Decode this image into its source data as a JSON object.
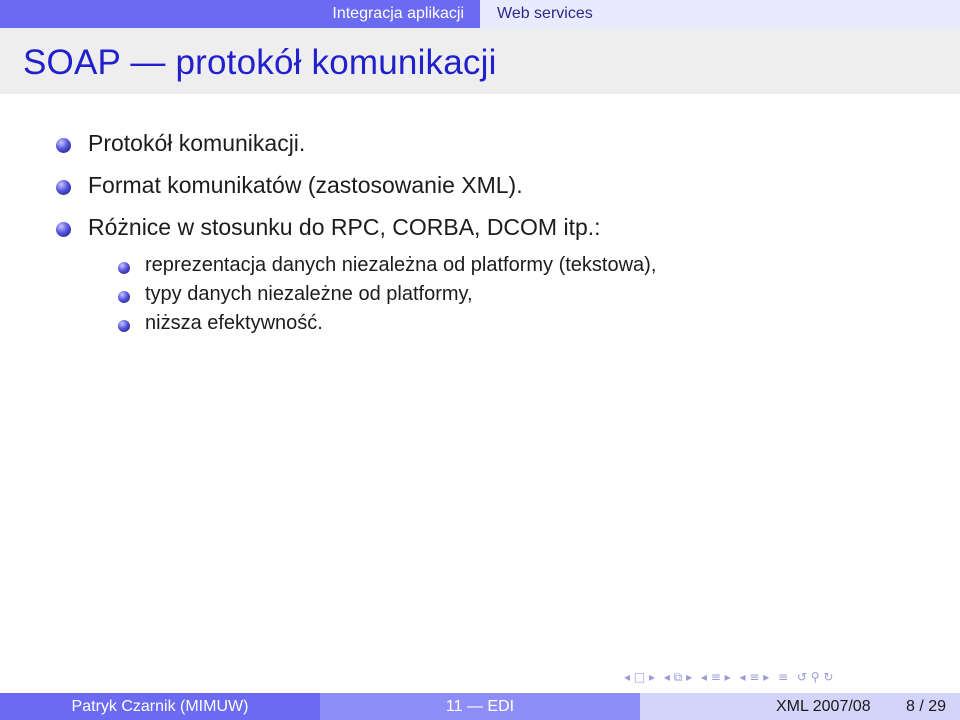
{
  "header": {
    "section": "Integracja aplikacji",
    "subsection": "Web services"
  },
  "frame": {
    "title": "SOAP — protokół komunikacji",
    "items": [
      "Protokół komunikacji.",
      "Format komunikatów (zastosowanie XML).",
      "Różnice w stosunku do RPC, CORBA, DCOM itp.:"
    ],
    "subitems": [
      "reprezentacja danych niezależna od platformy (tekstowa),",
      "typy danych niezależne od platformy,",
      "niższa efektywność."
    ]
  },
  "footer": {
    "author": "Patryk Czarnik  (MIMUW)",
    "title": "11 — EDI",
    "date": "XML 2007/08",
    "page": "8 / 29"
  },
  "navigation": {
    "icons": [
      "nav-first-icon",
      "nav-frame-icon",
      "nav-subsection-icon",
      "nav-section-icon",
      "nav-align-icon",
      "nav-search-icon"
    ]
  }
}
